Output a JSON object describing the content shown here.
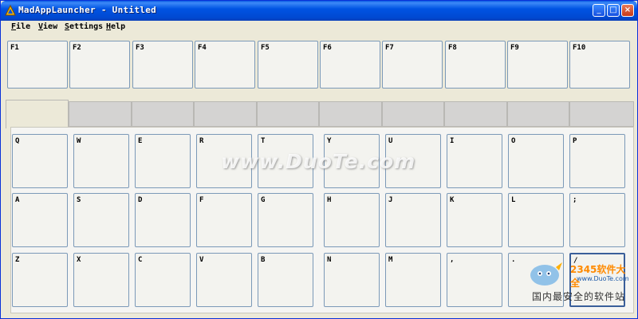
{
  "window": {
    "title": "MadAppLauncher - Untitled",
    "controls": {
      "minimize": "_",
      "maximize": "□",
      "close": "×"
    }
  },
  "menu": [
    {
      "label": "File",
      "underline": "F",
      "rest": "ile"
    },
    {
      "label": "View",
      "underline": "V",
      "rest": "iew"
    },
    {
      "label": "Settings",
      "underline": "S",
      "rest": "ettings"
    },
    {
      "label": "Help",
      "underline": "H",
      "rest": "elp"
    }
  ],
  "function_keys": [
    "F1",
    "F2",
    "F3",
    "F4",
    "F5",
    "F6",
    "F7",
    "F8",
    "F9",
    "F10"
  ],
  "tabs": {
    "count": 10,
    "active_index": 0
  },
  "keyboard": {
    "rows": [
      [
        "Q",
        "W",
        "E",
        "R",
        "T",
        "Y",
        "U",
        "I",
        "O",
        "P"
      ],
      [
        "A",
        "S",
        "D",
        "F",
        "G",
        "H",
        "J",
        "K",
        "L",
        ";"
      ],
      [
        "Z",
        "X",
        "C",
        "V",
        "B",
        "N",
        "M",
        ",",
        ".",
        "/"
      ]
    ],
    "focused_key": "/"
  },
  "watermark": {
    "text": "www.DuoTe.com",
    "brand": "2345软件大全",
    "site": "www.DuoTe.com",
    "slogan": "国内最安全的软件站"
  }
}
